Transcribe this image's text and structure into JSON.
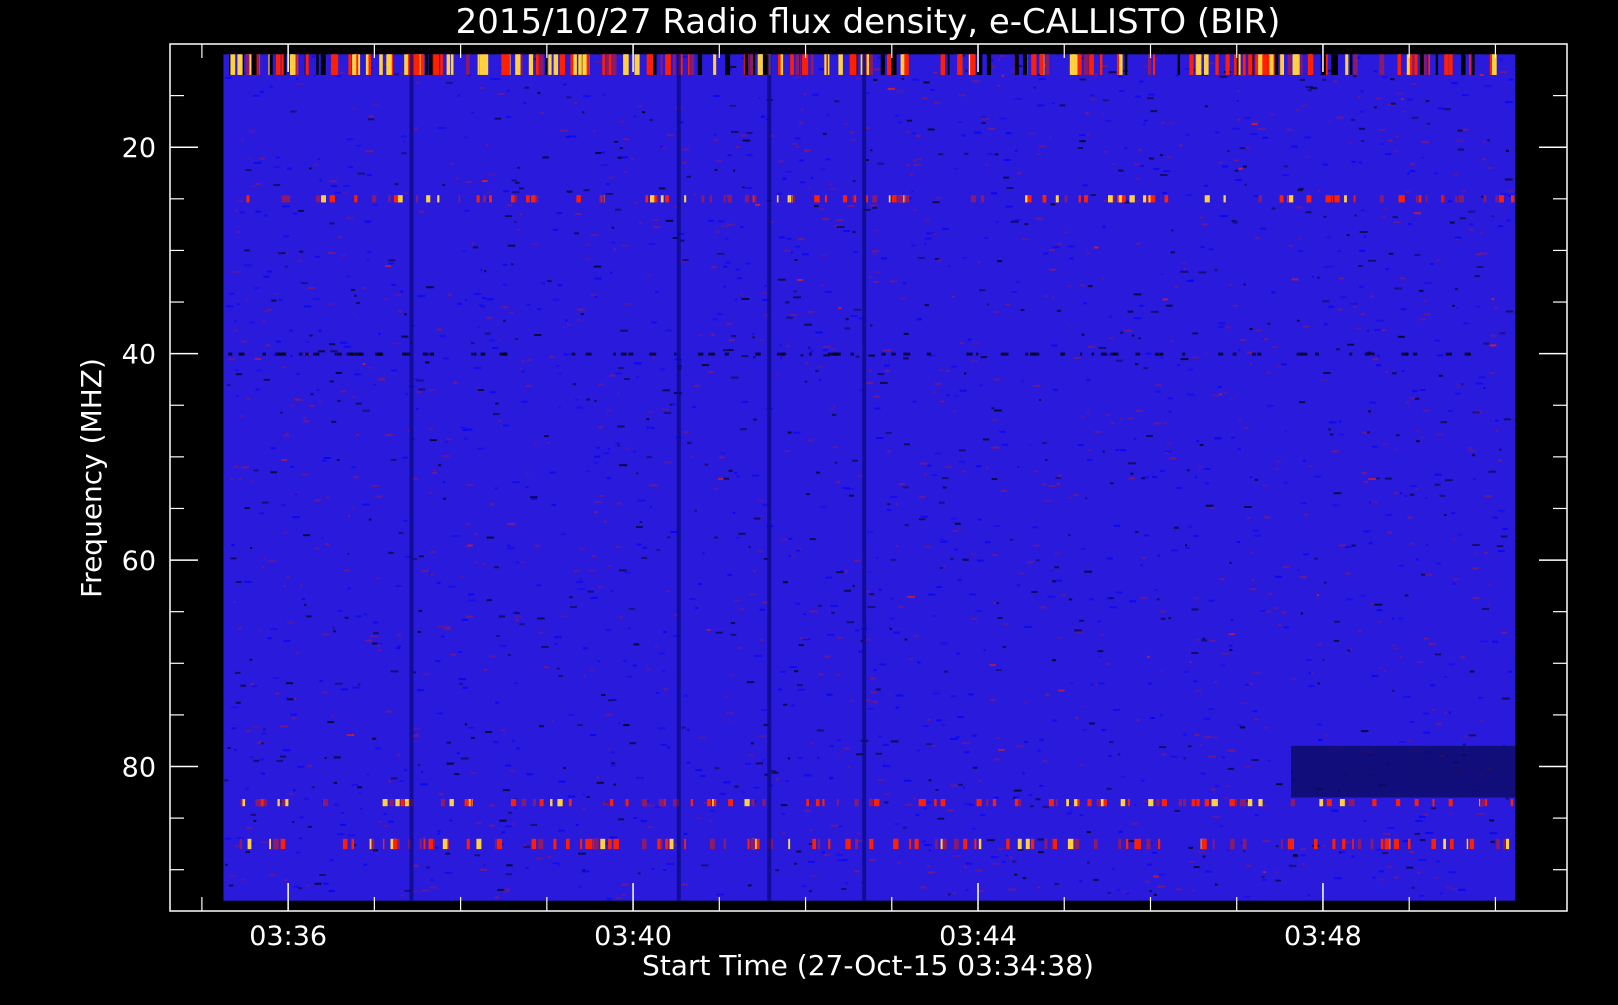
{
  "chart_data": {
    "type": "heatmap",
    "title": "2015/10/27  Radio flux density, e-CALLISTO (BIR)",
    "xlabel": "Start Time (27-Oct-15 03:34:38)",
    "ylabel": "Frequency (MHZ)",
    "x_start": "03:34:38",
    "x_range_minutes": [
      0,
      16.2
    ],
    "y_range_mhz": [
      10,
      94
    ],
    "x_ticks": [
      {
        "label": "03:36",
        "minute": 1.37
      },
      {
        "label": "03:40",
        "minute": 5.37
      },
      {
        "label": "03:44",
        "minute": 9.37
      },
      {
        "label": "03:48",
        "minute": 13.37
      }
    ],
    "x_minor_ticks_minutes": [
      0.37,
      2.37,
      3.37,
      4.37,
      6.37,
      7.37,
      8.37,
      10.37,
      11.37,
      12.37,
      14.37,
      15.37
    ],
    "y_ticks": [
      {
        "label": "20",
        "mhz": 20
      },
      {
        "label": "40",
        "mhz": 40
      },
      {
        "label": "60",
        "mhz": 60
      },
      {
        "label": "80",
        "mhz": 80
      }
    ],
    "y_minor_ticks_mhz": [
      15,
      25,
      30,
      35,
      45,
      50,
      55,
      65,
      70,
      75,
      85,
      90
    ],
    "data_extent": {
      "minute_start": 0.62,
      "minute_end": 15.6,
      "mhz_start": 11,
      "mhz_end": 93
    },
    "colormap": [
      "#000000",
      "#0000ff",
      "#8a1a6a",
      "#ff2000",
      "#ffd040"
    ],
    "background_color": "#2a1adc",
    "features": [
      {
        "kind": "hot-band",
        "mhz_start": 11,
        "mhz_end": 13,
        "minute_start": 0.62,
        "minute_end": 15.6,
        "intensity": "high"
      },
      {
        "kind": "hot-band",
        "mhz": 25,
        "minute_start": 0.62,
        "minute_end": 15.6,
        "intensity": "medium"
      },
      {
        "kind": "hot-band",
        "mhz": 83.5,
        "minute_start": 0.62,
        "minute_end": 15.6,
        "intensity": "medium"
      },
      {
        "kind": "hot-band",
        "mhz_start": 87,
        "mhz_end": 88,
        "minute_start": 0.62,
        "minute_end": 15.6,
        "intensity": "medium"
      },
      {
        "kind": "dark-band",
        "mhz": 40,
        "minute_start": 0.62,
        "minute_end": 15.6
      },
      {
        "kind": "dark-patch",
        "mhz_start": 78,
        "mhz_end": 83,
        "minute_start": 13.0,
        "minute_end": 15.6
      },
      {
        "kind": "dark-column",
        "minute": 2.8
      },
      {
        "kind": "dark-column",
        "minute": 5.9
      },
      {
        "kind": "dark-column",
        "minute": 6.95
      },
      {
        "kind": "dark-column",
        "minute": 8.05
      }
    ]
  }
}
